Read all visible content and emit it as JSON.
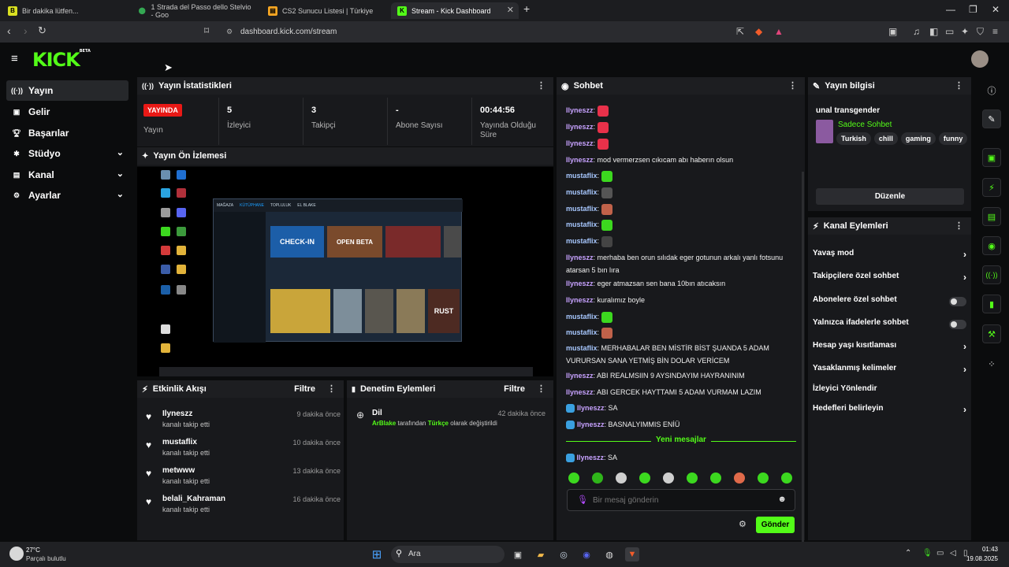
{
  "browser": {
    "tabs": [
      {
        "title": "Bir dakika lütfen...",
        "favicon_color": "#d9e021"
      },
      {
        "title": "1 Strada del Passo dello Stelvio - Goo",
        "favicon_color": "#34a853"
      },
      {
        "title": "CS2 Sunucu Listesi | Türkiye",
        "favicon_color": "#f5a623"
      },
      {
        "title": "Stream - Kick Dashboard",
        "favicon_color": "#53fc18"
      }
    ],
    "url": "dashboard.kick.com/stream"
  },
  "brand": {
    "logo": "KICK",
    "beta": "BETA",
    "accent": "#53fc18"
  },
  "sidebar": {
    "items": [
      {
        "label": "Yayın",
        "icon": "broadcast-icon",
        "glyph": "((·))",
        "active": true,
        "expandable": false
      },
      {
        "label": "Gelir",
        "icon": "revenue-icon",
        "glyph": "▣",
        "active": false,
        "expandable": false
      },
      {
        "label": "Başarılar",
        "icon": "trophy-icon",
        "glyph": "🏆︎",
        "active": false,
        "expandable": false
      },
      {
        "label": "Stüdyo",
        "icon": "studio-icon",
        "glyph": "✱",
        "active": false,
        "expandable": true
      },
      {
        "label": "Kanal",
        "icon": "channel-icon",
        "glyph": "▤",
        "active": false,
        "expandable": true
      },
      {
        "label": "Ayarlar",
        "icon": "settings-icon",
        "glyph": "⚙",
        "active": false,
        "expandable": true
      }
    ]
  },
  "stats": {
    "title": "Yayın İstatistikleri",
    "live_badge": "YAYINDA",
    "live_label": "Yayın",
    "items": [
      {
        "value": "5",
        "label": "İzleyici"
      },
      {
        "value": "3",
        "label": "Takipçi"
      },
      {
        "value": "-",
        "label": "Abone Sayısı"
      },
      {
        "value": "00:44:56",
        "label": "Yayında Olduğu Süre"
      }
    ]
  },
  "preview": {
    "title": "Yayın Ön İzlemesi"
  },
  "activity": {
    "title": "Etkinlik Akışı",
    "filter": "Filtre",
    "items": [
      {
        "name": "Ilyneszz",
        "action": "kanalı takip etti",
        "time": "9 dakika önce"
      },
      {
        "name": "mustaflix",
        "action": "kanalı takip etti",
        "time": "10 dakika önce"
      },
      {
        "name": "metwww",
        "action": "kanalı takip etti",
        "time": "13 dakika önce"
      },
      {
        "name": "belali_Kahraman",
        "action": "kanalı takip etti",
        "time": "16 dakika önce"
      }
    ]
  },
  "moderation": {
    "title": "Denetim Eylemleri",
    "filter": "Filtre",
    "item": {
      "heading": "Dil",
      "time": "42 dakika önce",
      "actor": "ArBlake",
      "mid": " tarafından ",
      "value": "Türkçe",
      "tail": " olarak değiştirildi"
    }
  },
  "chat": {
    "title": "Sohbet",
    "new_messages": "Yeni mesajlar",
    "messages": [
      {
        "user": "Ilyneszz",
        "text": "",
        "emote": "#e8314a",
        "user_color": "#c7a2ff"
      },
      {
        "user": "Ilyneszz",
        "text": "",
        "emote": "#e8314a",
        "user_color": "#c7a2ff"
      },
      {
        "user": "Ilyneszz",
        "text": "",
        "emote": "#e8314a",
        "user_color": "#c7a2ff"
      },
      {
        "user": "Ilyneszz",
        "text": "mod vermerzsen cıkıcam abı haberın olsun",
        "emote": "",
        "user_color": "#c7a2ff"
      },
      {
        "user": "mustaflix",
        "text": "",
        "emote": "#3cd81f",
        "user_color": "#a8c8ff"
      },
      {
        "user": "mustaflix",
        "text": "",
        "emote": "#555555",
        "user_color": "#a8c8ff"
      },
      {
        "user": "mustaflix",
        "text": "",
        "emote": "#c0624a",
        "user_color": "#a8c8ff"
      },
      {
        "user": "mustaflix",
        "text": "",
        "emote": "#3cd81f",
        "user_color": "#a8c8ff"
      },
      {
        "user": "mustaflix",
        "text": "",
        "emote": "#444444",
        "user_color": "#a8c8ff"
      },
      {
        "user": "Ilyneszz",
        "text": "merhaba ben orun sılıdak eger gotunun arkalı yanlı fotsunu atarsan 5 bın lıra",
        "emote": "",
        "user_color": "#c7a2ff"
      },
      {
        "user": "Ilyneszz",
        "text": "eger atmazsan sen bana 10bın atıcaksın",
        "emote": "",
        "user_color": "#c7a2ff"
      },
      {
        "user": "Ilyneszz",
        "text": "kuralımız boyle",
        "emote": "",
        "user_color": "#c7a2ff"
      },
      {
        "user": "mustaflix",
        "text": "",
        "emote": "#3cd81f",
        "user_color": "#a8c8ff"
      },
      {
        "user": "mustaflix",
        "text": "",
        "emote": "#c0624a",
        "user_color": "#a8c8ff"
      },
      {
        "user": "mustaflix",
        "text": "MERHABALAR BEN MİSTİR BİST ŞUANDA 5 ADAM VURURSAN SANA YETMİŞ BİN DOLAR VERİCEM",
        "emote": "",
        "user_color": "#a8c8ff"
      },
      {
        "user": "Ilyneszz",
        "text": "ABI REALMSIIN 9 AYSINDAYIM HAYRANINIM",
        "emote": "",
        "user_color": "#c7a2ff"
      },
      {
        "user": "Ilyneszz",
        "text": "ABI GERCEK HAYTTAMI 5 ADAM VURMAM LAZIM",
        "emote": "",
        "user_color": "#c7a2ff"
      },
      {
        "user": "Ilyneszz",
        "text": "SA",
        "emote": "",
        "user_color": "#c7a2ff",
        "badge": true
      },
      {
        "user": "Ilyneszz",
        "text": "BASNALYIMMIS ENİÜ",
        "emote": "",
        "user_color": "#c7a2ff",
        "badge": true
      }
    ],
    "after_new": {
      "user": "Ilyneszz",
      "text": "SA",
      "user_color": "#c7a2ff"
    },
    "input_placeholder": "Bir mesaj gönderin",
    "send": "Gönder"
  },
  "stream_info": {
    "title": "Yayın bilgisi",
    "stream_title": "unal transgender",
    "category": "Sadece Sohbet",
    "tags": [
      "Turkish",
      "chill",
      "gaming",
      "funny"
    ],
    "edit": "Düzenle"
  },
  "channel_actions": {
    "title": "Kanal Eylemleri",
    "items": [
      {
        "label": "Yavaş mod",
        "kind": "chevron"
      },
      {
        "label": "Takipçilere özel sohbet",
        "kind": "chevron"
      },
      {
        "label": "Abonelere özel sohbet",
        "kind": "toggle"
      },
      {
        "label": "Yalnızca ifadelerle sohbet",
        "kind": "toggle"
      },
      {
        "label": "Hesap yaşı kısıtlaması",
        "kind": "chevron"
      },
      {
        "label": "Yasaklanmış kelimeler",
        "kind": "chevron"
      },
      {
        "label": "İzleyici Yönlendir",
        "kind": "none"
      },
      {
        "label": "Hedefleri belirleyin",
        "kind": "chevron"
      }
    ]
  },
  "taskbar": {
    "weather_temp": "27°C",
    "weather_desc": "Parçalı bulutlu",
    "search": "Ara",
    "time": "01:43",
    "date": "19.08.2025"
  },
  "desktop_preview": {
    "tabs": [
      "MAĞAZA",
      "KÜTÜPHANE",
      "TOPLULUK",
      "EL BLAKE"
    ],
    "game1": "CHECK-IN",
    "game2": "OPEN BETA",
    "game3": "RUST"
  }
}
